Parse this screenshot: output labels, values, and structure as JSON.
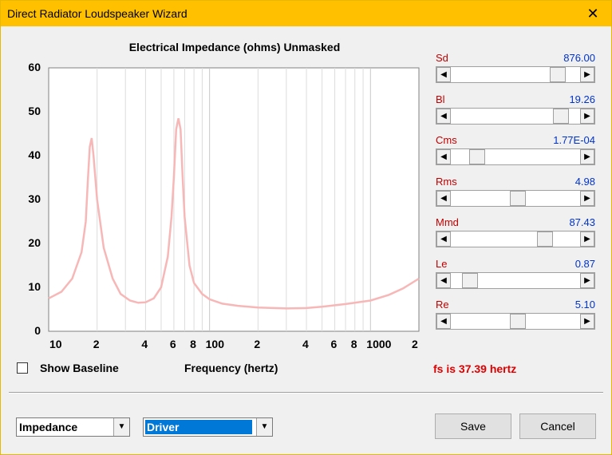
{
  "window": {
    "title": "Direct Radiator Loudspeaker Wizard",
    "close_glyph": "✕"
  },
  "chart": {
    "title": "Electrical Impedance (ohms)   Unmasked",
    "y_ticks": [
      "60",
      "50",
      "40",
      "30",
      "20",
      "10",
      "0"
    ],
    "x_ticks": [
      "10",
      "2",
      "4",
      "6",
      "8",
      "100",
      "2",
      "4",
      "6",
      "8",
      "1000",
      "2"
    ],
    "xlabel": "Frequency (hertz)"
  },
  "chart_data": {
    "type": "line",
    "title": "Electrical Impedance (ohms)   Unmasked",
    "xlabel": "Frequency (hertz)",
    "ylabel": "",
    "x_scale": "log",
    "xlim": [
      10,
      2000
    ],
    "ylim": [
      0,
      60
    ],
    "grid": true,
    "series": [
      {
        "color": "#f7b7b7",
        "x": [
          10,
          12,
          14,
          16,
          17,
          17.5,
          18,
          18.5,
          19,
          20,
          22,
          25,
          28,
          32,
          36,
          40,
          45,
          50,
          55,
          58,
          60,
          62,
          64,
          66,
          68,
          70,
          75,
          80,
          90,
          100,
          120,
          150,
          200,
          300,
          400,
          500,
          700,
          1000,
          1300,
          1600,
          2000
        ],
        "y": [
          7.5,
          9,
          12,
          18,
          25,
          34,
          42,
          44,
          40,
          30,
          19,
          12,
          8.5,
          7,
          6.5,
          6.6,
          7.5,
          10,
          17,
          26,
          35,
          46,
          48.5,
          46,
          35,
          26,
          15,
          11,
          8.5,
          7.3,
          6.3,
          5.8,
          5.4,
          5.2,
          5.3,
          5.6,
          6.2,
          7,
          8.3,
          9.8,
          12
        ]
      }
    ]
  },
  "params": [
    {
      "name": "Sd",
      "value": "876.00",
      "pos": 0.87
    },
    {
      "name": "Bl",
      "value": "19.26",
      "pos": 0.9
    },
    {
      "name": "Cms",
      "value": "1.77E-04",
      "pos": 0.16
    },
    {
      "name": "Rms",
      "value": "4.98",
      "pos": 0.52
    },
    {
      "name": "Mmd",
      "value": "87.43",
      "pos": 0.76
    },
    {
      "name": "Le",
      "value": "0.87",
      "pos": 0.1
    },
    {
      "name": "Re",
      "value": "5.10",
      "pos": 0.52
    }
  ],
  "controls": {
    "show_baseline_label": "Show Baseline",
    "show_baseline_checked": false,
    "fs_text": "fs is 37.39 hertz",
    "view_select": "Impedance",
    "source_select": "Driver",
    "save_label": "Save",
    "cancel_label": "Cancel"
  },
  "colors": {
    "title_bar": "#ffc000",
    "curve": "#f7b7b7",
    "param_name": "#c00000",
    "param_value": "#0033cc",
    "fs_text": "#e00000",
    "selection": "#0078d7"
  }
}
